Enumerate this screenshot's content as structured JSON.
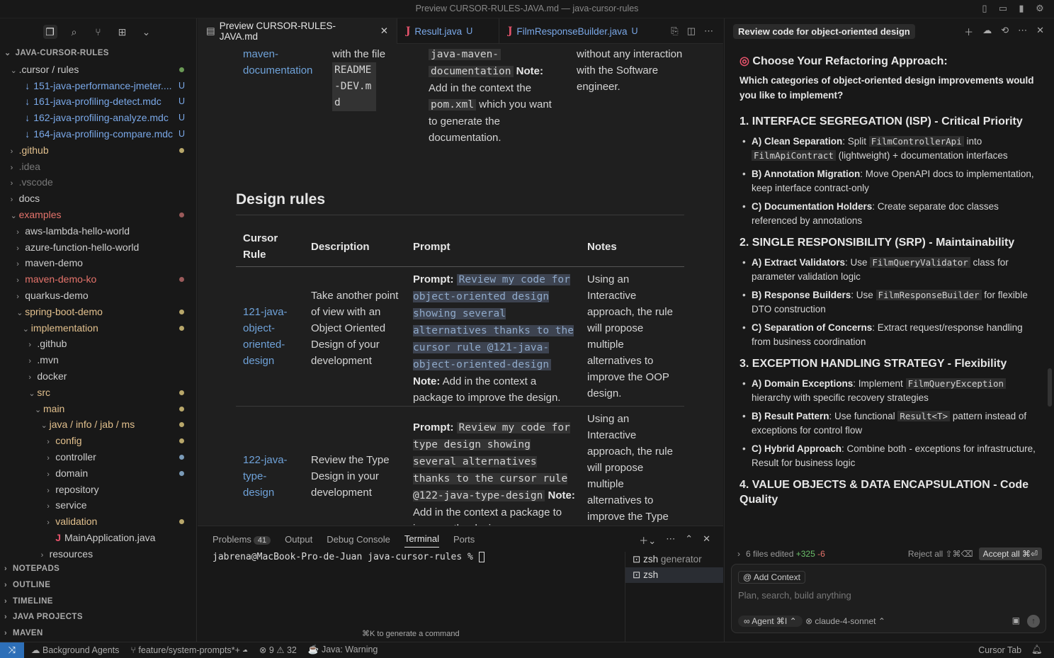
{
  "window": {
    "title": "Preview CURSOR-RULES-JAVA.md — java-cursor-rules"
  },
  "explorer": {
    "root": "JAVA-CURSOR-RULES",
    "items": [
      {
        "label": ".cursor / rules",
        "indent": 1,
        "chev": "⌄",
        "color": "wh",
        "dot": "#6a9955"
      },
      {
        "label": "151-java-performance-jmeter....",
        "indent": 2,
        "chev": "",
        "color": "blu",
        "badge": "U",
        "icon": "↓"
      },
      {
        "label": "161-java-profiling-detect.mdc",
        "indent": 2,
        "chev": "",
        "color": "blu",
        "badge": "U",
        "icon": "↓"
      },
      {
        "label": "162-java-profiling-analyze.mdc",
        "indent": 2,
        "chev": "",
        "color": "blu",
        "badge": "U",
        "icon": "↓"
      },
      {
        "label": "164-java-profiling-compare.mdc",
        "indent": 2,
        "chev": "",
        "color": "blu",
        "badge": "U",
        "icon": "↓"
      },
      {
        "label": ".github",
        "indent": 1,
        "chev": "›",
        "color": "yel",
        "dot": "#b8a76a"
      },
      {
        "label": ".idea",
        "indent": 1,
        "chev": "›",
        "color": "gry"
      },
      {
        "label": ".vscode",
        "indent": 1,
        "chev": "›",
        "color": "gry"
      },
      {
        "label": "docs",
        "indent": 1,
        "chev": "›",
        "color": "wh"
      },
      {
        "label": "examples",
        "indent": 1,
        "chev": "⌄",
        "color": "red",
        "dot": "#9b5a5a"
      },
      {
        "label": "aws-lambda-hello-world",
        "indent": 2,
        "chev": "›",
        "color": "wh"
      },
      {
        "label": "azure-function-hello-world",
        "indent": 2,
        "chev": "›",
        "color": "wh"
      },
      {
        "label": "maven-demo",
        "indent": 2,
        "chev": "›",
        "color": "wh"
      },
      {
        "label": "maven-demo-ko",
        "indent": 2,
        "chev": "›",
        "color": "red",
        "dot": "#9b5a5a"
      },
      {
        "label": "quarkus-demo",
        "indent": 2,
        "chev": "›",
        "color": "wh"
      },
      {
        "label": "spring-boot-demo",
        "indent": 2,
        "chev": "⌄",
        "color": "yel",
        "dot": "#b8a76a"
      },
      {
        "label": "implementation",
        "indent": 3,
        "chev": "⌄",
        "color": "yel",
        "dot": "#b8a76a"
      },
      {
        "label": ".github",
        "indent": 4,
        "chev": "›",
        "color": "wh"
      },
      {
        "label": ".mvn",
        "indent": 4,
        "chev": "›",
        "color": "wh"
      },
      {
        "label": "docker",
        "indent": 4,
        "chev": "›",
        "color": "wh"
      },
      {
        "label": "src",
        "indent": 4,
        "chev": "⌄",
        "color": "yel",
        "dot": "#b8a76a"
      },
      {
        "label": "main",
        "indent": 5,
        "chev": "⌄",
        "color": "yel",
        "dot": "#b8a76a"
      },
      {
        "label": "java / info / jab / ms",
        "indent": 6,
        "chev": "⌄",
        "color": "yel",
        "dot": "#b8a76a"
      },
      {
        "label": "config",
        "indent": 7,
        "chev": "›",
        "color": "yel",
        "dot": "#b8a76a"
      },
      {
        "label": "controller",
        "indent": 7,
        "chev": "›",
        "color": "wh",
        "dot": "#7a9bb8"
      },
      {
        "label": "domain",
        "indent": 7,
        "chev": "›",
        "color": "wh",
        "dot": "#7a9bb8"
      },
      {
        "label": "repository",
        "indent": 7,
        "chev": "›",
        "color": "wh"
      },
      {
        "label": "service",
        "indent": 7,
        "chev": "›",
        "color": "wh"
      },
      {
        "label": "validation",
        "indent": 7,
        "chev": "›",
        "color": "yel",
        "dot": "#b8a76a"
      },
      {
        "label": "MainApplication.java",
        "indent": 7,
        "chev": "",
        "color": "wh",
        "icon": "J"
      },
      {
        "label": "resources",
        "indent": 6,
        "chev": "›",
        "color": "wh"
      }
    ],
    "sections": [
      "NOTEPADS",
      "OUTLINE",
      "TIMELINE",
      "JAVA PROJECTS",
      "MAVEN"
    ]
  },
  "tabs": [
    {
      "label": "Preview CURSOR-RULES-JAVA.md",
      "status": "",
      "active": true
    },
    {
      "label": "Result.java",
      "status": "U",
      "active": false
    },
    {
      "label": "FilmResponseBuilder.java",
      "status": "U",
      "active": false
    }
  ],
  "preview": {
    "top": {
      "c1": "maven-documentation",
      "c2_line1": "with the file",
      "c2_code": "README-DEV.md",
      "c3_code1": "java-maven-",
      "c3_code2": "documentation",
      "c3_note": "Note:",
      "c3_text1": "Add in the context the",
      "c3_code3": "pom.xml",
      "c3_text2": "which you want to generate the documentation.",
      "c4": "without any interaction with the Software engineer."
    },
    "heading": "Design rules",
    "headers": [
      "Cursor Rule",
      "Description",
      "Prompt",
      "Notes"
    ],
    "rows": [
      {
        "rule": "121-java-object-oriented-design",
        "description": "Take another point of view with an Object Oriented Design of your development",
        "prompt_label": "Prompt:",
        "prompt_code": "Review my code for object-oriented design showing several alternatives thanks to the cursor rule @121-java-object-oriented-design",
        "note_label": "Note:",
        "note_text": "Add in the context a package to improve the design.",
        "notes": "Using an Interactive approach, the rule will propose multiple alternatives to improve the OOP design."
      },
      {
        "rule": "122-java-type-design",
        "description": "Review the Type Design in your development",
        "prompt_label": "Prompt:",
        "prompt_code": "Review my code for type design showing several alternatives thanks to the cursor rule @122-java-type-design",
        "note_label": "Note:",
        "note_text": "Add in the context a package to improve the design.",
        "notes": "Using an Interactive approach, the rule will propose multiple alternatives to improve the Type design."
      }
    ]
  },
  "panel": {
    "tabs": [
      "Problems",
      "Output",
      "Debug Console",
      "Terminal",
      "Ports"
    ],
    "problems_count": "41",
    "prompt": "jabrena@MacBook-Pro-de-Juan java-cursor-rules %",
    "terminals": [
      {
        "name": "zsh",
        "extra": "generator"
      },
      {
        "name": "zsh",
        "extra": ""
      }
    ],
    "hint": "⌘K to generate a command"
  },
  "chat": {
    "title": "Review code for object-oriented design",
    "heading": "Choose Your Refactoring Approach:",
    "question": "Which categories of object-oriented design improvements would you like to implement?",
    "sections": [
      {
        "title": "1. INTERFACE SEGREGATION (ISP) - Critical Priority",
        "items": [
          {
            "bold": "A) Clean Separation",
            "pre": ": Split ",
            "code1": "FilmControllerApi",
            "mid": " into ",
            "code2": "FilmApiContract",
            "post": " (lightweight) + documentation interfaces"
          },
          {
            "bold": "B) Annotation Migration",
            "pre": ": Move OpenAPI docs to implementation, keep interface contract-only"
          },
          {
            "bold": "C) Documentation Holders",
            "pre": ": Create separate doc classes referenced by annotations"
          }
        ]
      },
      {
        "title": "2. SINGLE RESPONSIBILITY (SRP) - Maintainability",
        "items": [
          {
            "bold": "A) Extract Validators",
            "pre": ": Use ",
            "code1": "FilmQueryValidator",
            "post": " class for parameter validation logic"
          },
          {
            "bold": "B) Response Builders",
            "pre": ": Use ",
            "code1": "FilmResponseBuilder",
            "post": " for flexible DTO construction"
          },
          {
            "bold": "C) Separation of Concerns",
            "pre": ": Extract request/response handling from business coordination"
          }
        ]
      },
      {
        "title": "3. EXCEPTION HANDLING STRATEGY - Flexibility",
        "items": [
          {
            "bold": "A) Domain Exceptions",
            "pre": ": Implement ",
            "code1": "FilmQueryException",
            "post": " hierarchy with specific recovery strategies"
          },
          {
            "bold": "B) Result Pattern",
            "pre": ": Use functional ",
            "code1": "Result<T>",
            "post": " pattern instead of exceptions for control flow"
          },
          {
            "bold": "C) Hybrid Approach",
            "pre": ": Combine both - exceptions for infrastructure, Result for business logic"
          }
        ]
      },
      {
        "title": "4. VALUE OBJECTS & DATA ENCAPSULATION - Code Quality",
        "items": []
      }
    ],
    "edits": {
      "label": "6 files edited",
      "plus": "+325",
      "minus": "-6",
      "reject": "Reject all ⇧⌘⌫",
      "accept": "Accept all ⌘⏎"
    },
    "input": {
      "context": "Add Context",
      "placeholder": "Plan, search, build anything",
      "agent": "Agent ⌘I",
      "model": "claude-4-sonnet"
    }
  },
  "status": {
    "agents": "Background Agents",
    "branch": "feature/system-prompts*+",
    "errors": "9",
    "warnings": "32",
    "java": "Java: Warning",
    "tab": "Cursor Tab"
  }
}
